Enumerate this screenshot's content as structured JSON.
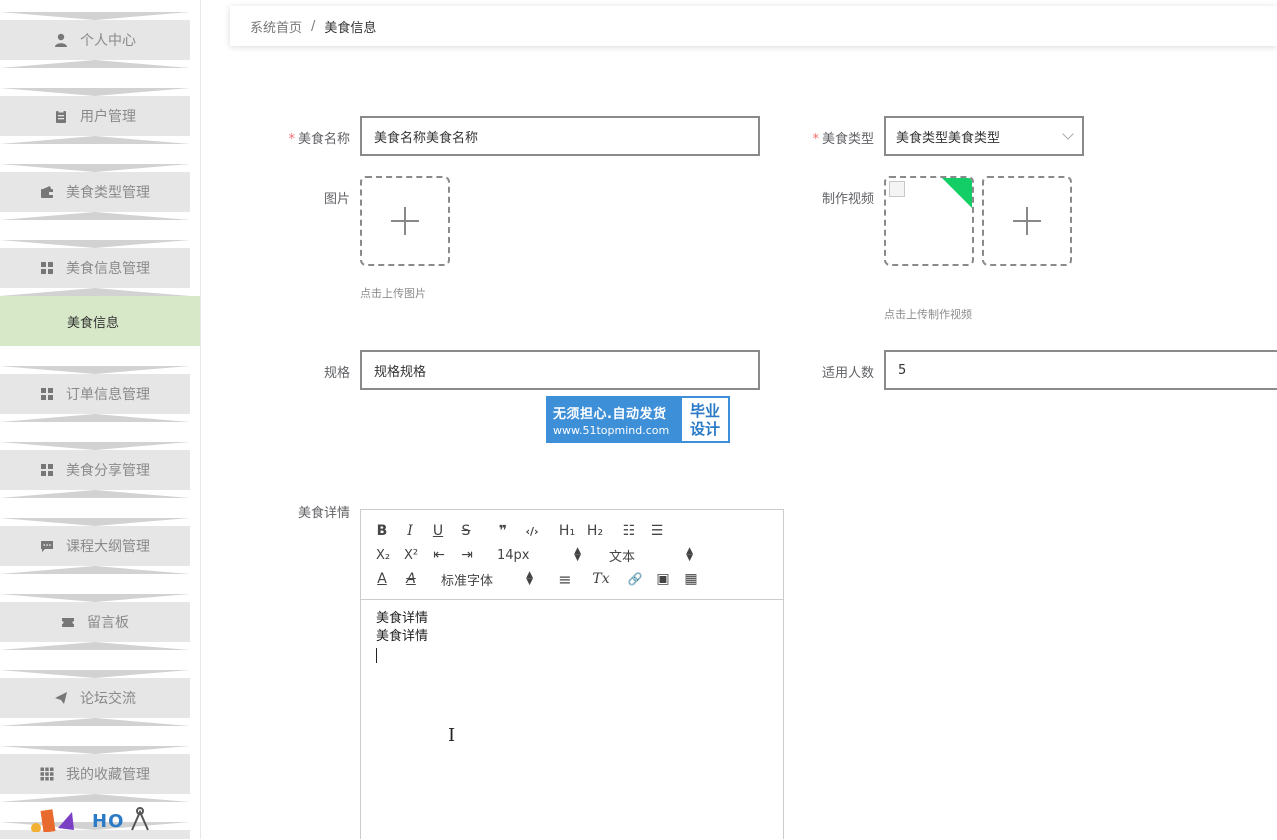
{
  "sidebar": {
    "items": [
      {
        "label": "个人中心",
        "icon": "user-icon"
      },
      {
        "label": "用户管理",
        "icon": "clipboard-icon"
      },
      {
        "label": "美食类型管理",
        "icon": "wallet-icon"
      },
      {
        "label": "美食信息管理",
        "icon": "grid-icon"
      },
      {
        "label": "订单信息管理",
        "icon": "grid-icon"
      },
      {
        "label": "美食分享管理",
        "icon": "grid-icon"
      },
      {
        "label": "课程大纲管理",
        "icon": "chat-icon"
      },
      {
        "label": "留言板",
        "icon": "ticket-icon"
      },
      {
        "label": "论坛交流",
        "icon": "send-icon"
      },
      {
        "label": "我的收藏管理",
        "icon": "apps-icon"
      }
    ],
    "active_submenu": "美食信息",
    "deco_text": "HO"
  },
  "breadcrumb": {
    "home": "系统首页",
    "separator": "/",
    "current": "美食信息"
  },
  "form": {
    "name_label": "美食名称",
    "name_value": "美食名称美食名称",
    "type_label": "美食类型",
    "type_value": "美食类型美食类型",
    "image_label": "图片",
    "image_hint": "点击上传图片",
    "video_label": "制作视频",
    "video_hint": "点击上传制作视频",
    "spec_label": "规格",
    "spec_value": "规格规格",
    "people_label": "适用人数",
    "people_value": "5",
    "detail_label": "美食详情"
  },
  "ad": {
    "line1": "无须担心.自动发货",
    "line2": "www.51topmind.com",
    "right_line1": "毕业",
    "right_line2": "设计"
  },
  "editor": {
    "toolbar": {
      "bold": "B",
      "italic": "I",
      "underline": "U",
      "strike": "S",
      "quote": "❞",
      "code": "‹/›",
      "h1": "H₁",
      "h2": "H₂",
      "ordered_list": "☷",
      "bullet_list": "☰",
      "subscript": "X₂",
      "superscript": "X²",
      "outdent": "⇤",
      "indent": "⇥",
      "size": "14px",
      "header_select": "文本",
      "font_color": "A",
      "background": "A",
      "font_select": "标准字体",
      "align": "≡",
      "clean": "Tx",
      "link": "🔗",
      "image": "▣",
      "video": "▦"
    },
    "content_lines": [
      "美食详情",
      "美食详情"
    ]
  },
  "colors": {
    "required": "#f56c6c",
    "active_submenu_bg": "#d7e8c8",
    "menu_bg": "#e6e6e6",
    "ad_blue": "#3d8fd8",
    "upload_corner": "#13ce66"
  }
}
